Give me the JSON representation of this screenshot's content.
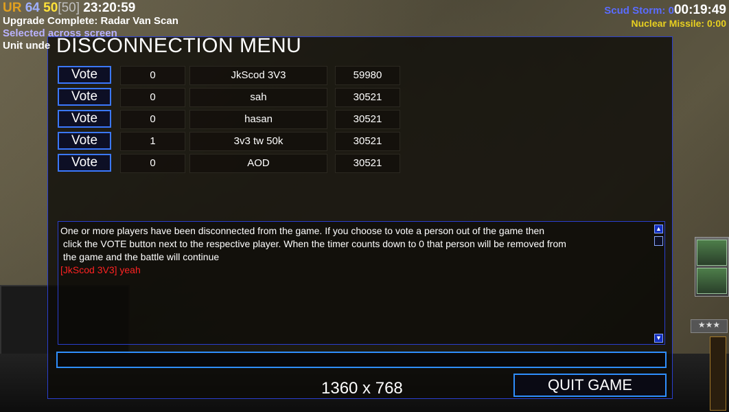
{
  "hud": {
    "ur": "UR",
    "value_a": "64",
    "value_b": "50",
    "value_c": "[50]",
    "clock": "23:20:59",
    "messages": [
      {
        "text": "Upgrade Complete: Radar Van Scan",
        "color": "#ffffff"
      },
      {
        "text": "Selected across screen",
        "color": "#b9b2ff"
      },
      {
        "text": "Unit unde",
        "color": "#ffffff"
      }
    ],
    "scud_label": "Scud Storm: 0",
    "scud_timer": "00:19:49",
    "nuke_label": "Nuclear Missile: 0:00",
    "stars": "★★★"
  },
  "dialog": {
    "title": "DISCONNECTION MENU",
    "vote_label": "Vote",
    "players": [
      {
        "votes": "0",
        "name": "JkScod 3V3",
        "ping": "59980"
      },
      {
        "votes": "0",
        "name": "sah",
        "ping": "30521"
      },
      {
        "votes": "0",
        "name": "hasan",
        "ping": "30521"
      },
      {
        "votes": "1",
        "name": "3v3 tw 50k",
        "ping": "30521"
      },
      {
        "votes": "0",
        "name": "AOD",
        "ping": "30521"
      }
    ],
    "chat": {
      "system_lines": [
        "One or more players have been disconnected from the game. If you choose to vote a person out of the game then",
        " click the VOTE button next to the respective player. When the timer counts down to 0 that person will be removed from",
        " the game and the battle will continue"
      ],
      "player_message": "[JkScod 3V3] yeah"
    },
    "chat_input_value": "",
    "resolution": "1360 x 768",
    "quit_label": "QUIT GAME"
  },
  "colors": {
    "accent_border": "#2f8fff",
    "chat_player_color": "#ff2222"
  }
}
